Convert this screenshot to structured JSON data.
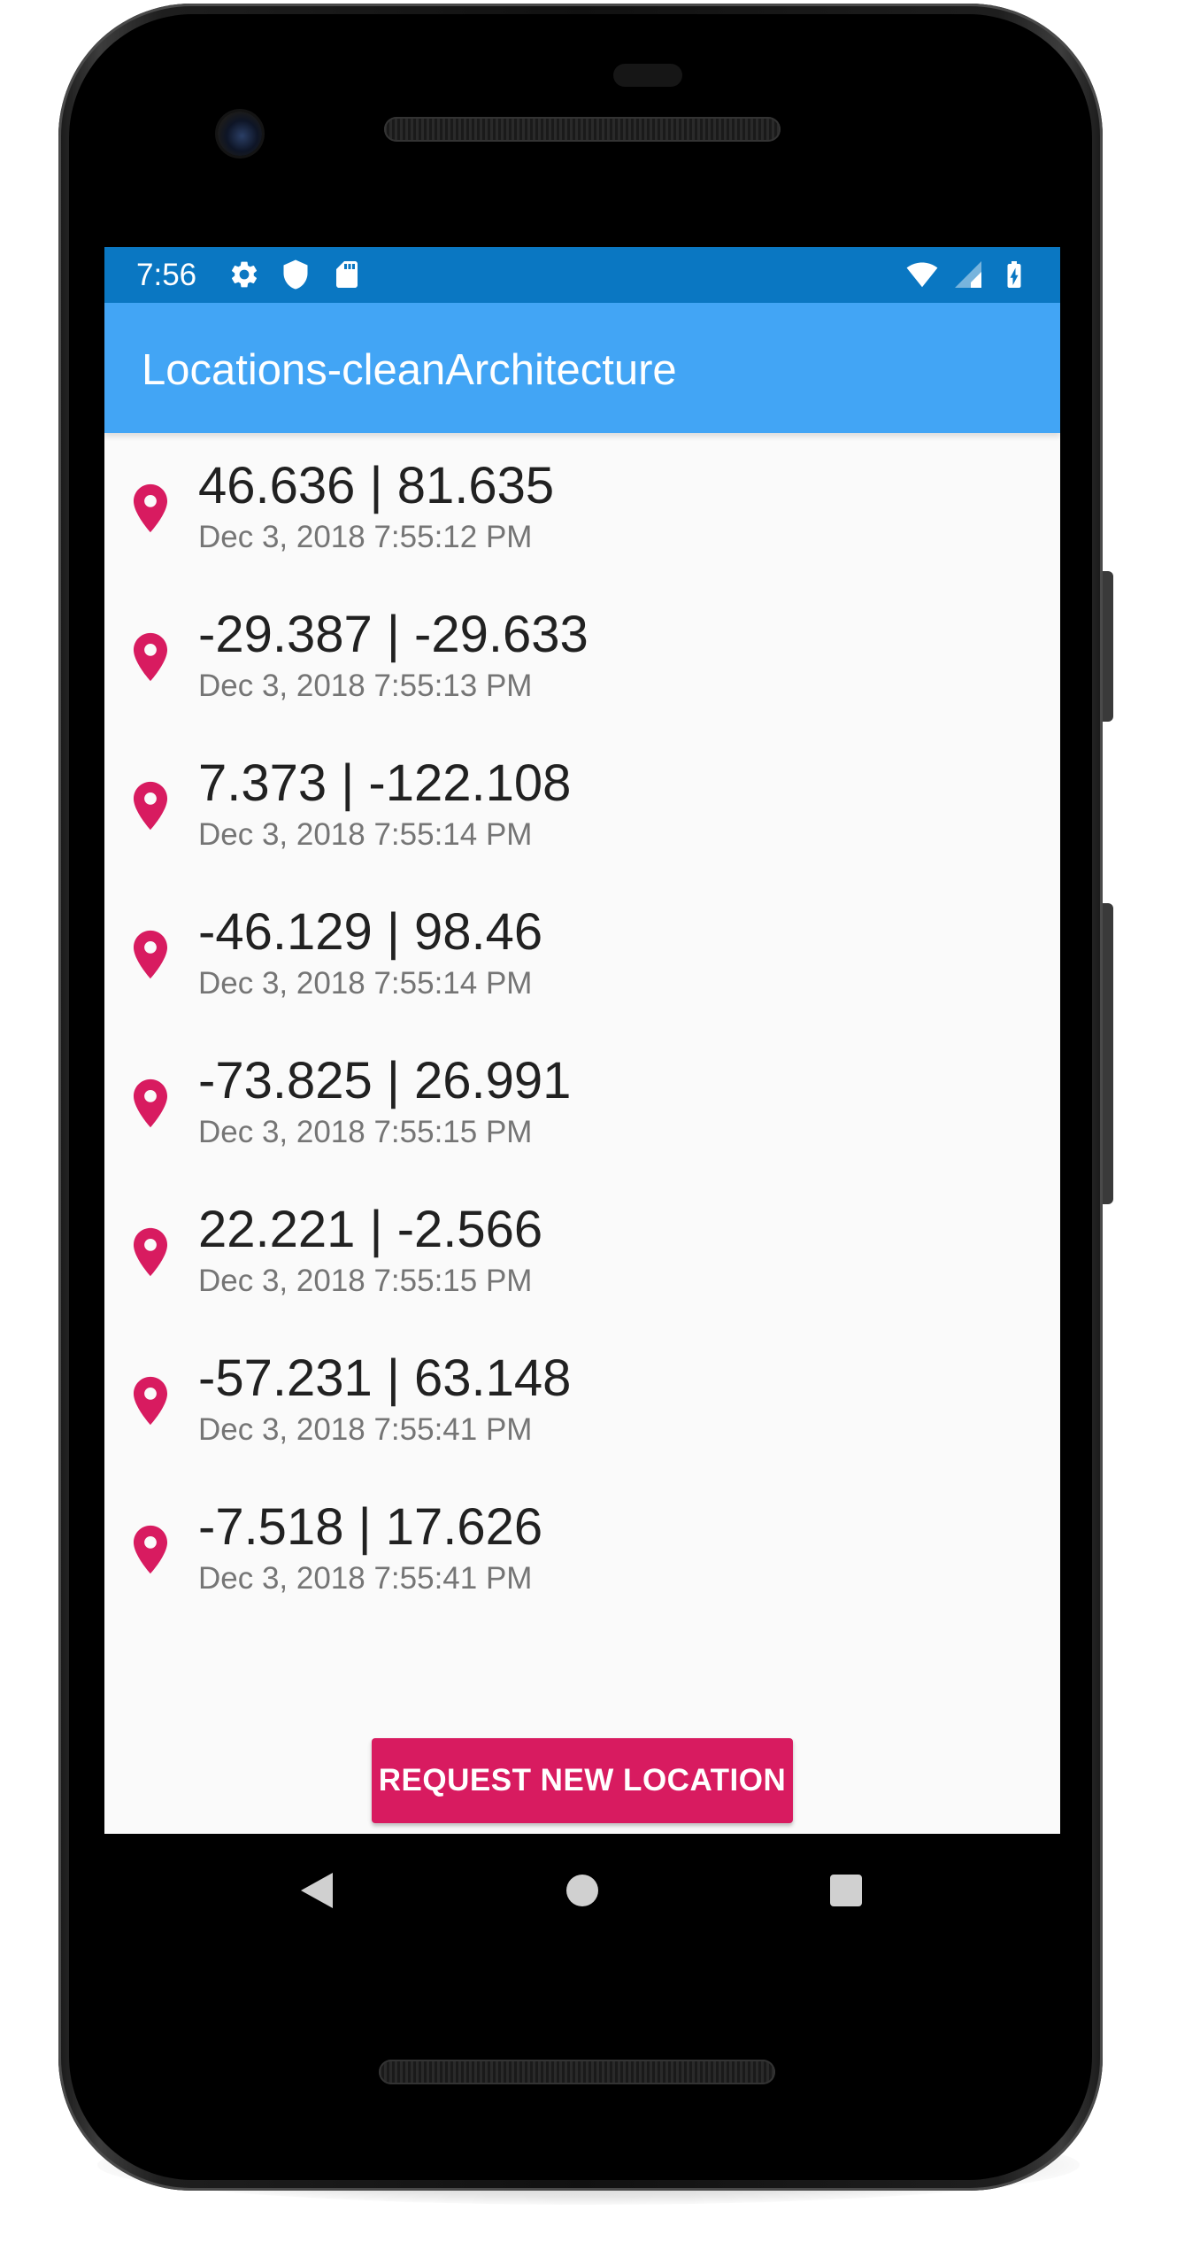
{
  "status_bar": {
    "time": "7:56",
    "left_icons": [
      "settings-icon",
      "shield-icon",
      "sd-card-icon"
    ],
    "right_icons": [
      "wifi-icon",
      "signal-icon",
      "battery-charging-icon"
    ]
  },
  "app_bar": {
    "title": "Locations-cleanArchitecture"
  },
  "locations": [
    {
      "coords": "46.636 | 81.635",
      "timestamp": "Dec 3, 2018 7:55:12 PM"
    },
    {
      "coords": "-29.387 | -29.633",
      "timestamp": "Dec 3, 2018 7:55:13 PM"
    },
    {
      "coords": "7.373 | -122.108",
      "timestamp": "Dec 3, 2018 7:55:14 PM"
    },
    {
      "coords": "-46.129 | 98.46",
      "timestamp": "Dec 3, 2018 7:55:14 PM"
    },
    {
      "coords": "-73.825 | 26.991",
      "timestamp": "Dec 3, 2018 7:55:15 PM"
    },
    {
      "coords": "22.221 | -2.566",
      "timestamp": "Dec 3, 2018 7:55:15 PM"
    },
    {
      "coords": "-57.231 | 63.148",
      "timestamp": "Dec 3, 2018 7:55:41 PM"
    },
    {
      "coords": "-7.518 | 17.626",
      "timestamp": "Dec 3, 2018 7:55:41 PM"
    }
  ],
  "actions": {
    "request_label": "REQUEST NEW LOCATION"
  },
  "nav_bar": {
    "icons": [
      "back-icon",
      "home-icon",
      "recents-icon"
    ]
  },
  "colors": {
    "status_bar": "#0a77c2",
    "app_bar": "#42a5f5",
    "accent": "#d81b60",
    "background": "#fafafa",
    "primary_text": "#212121",
    "secondary_text": "#757575"
  }
}
